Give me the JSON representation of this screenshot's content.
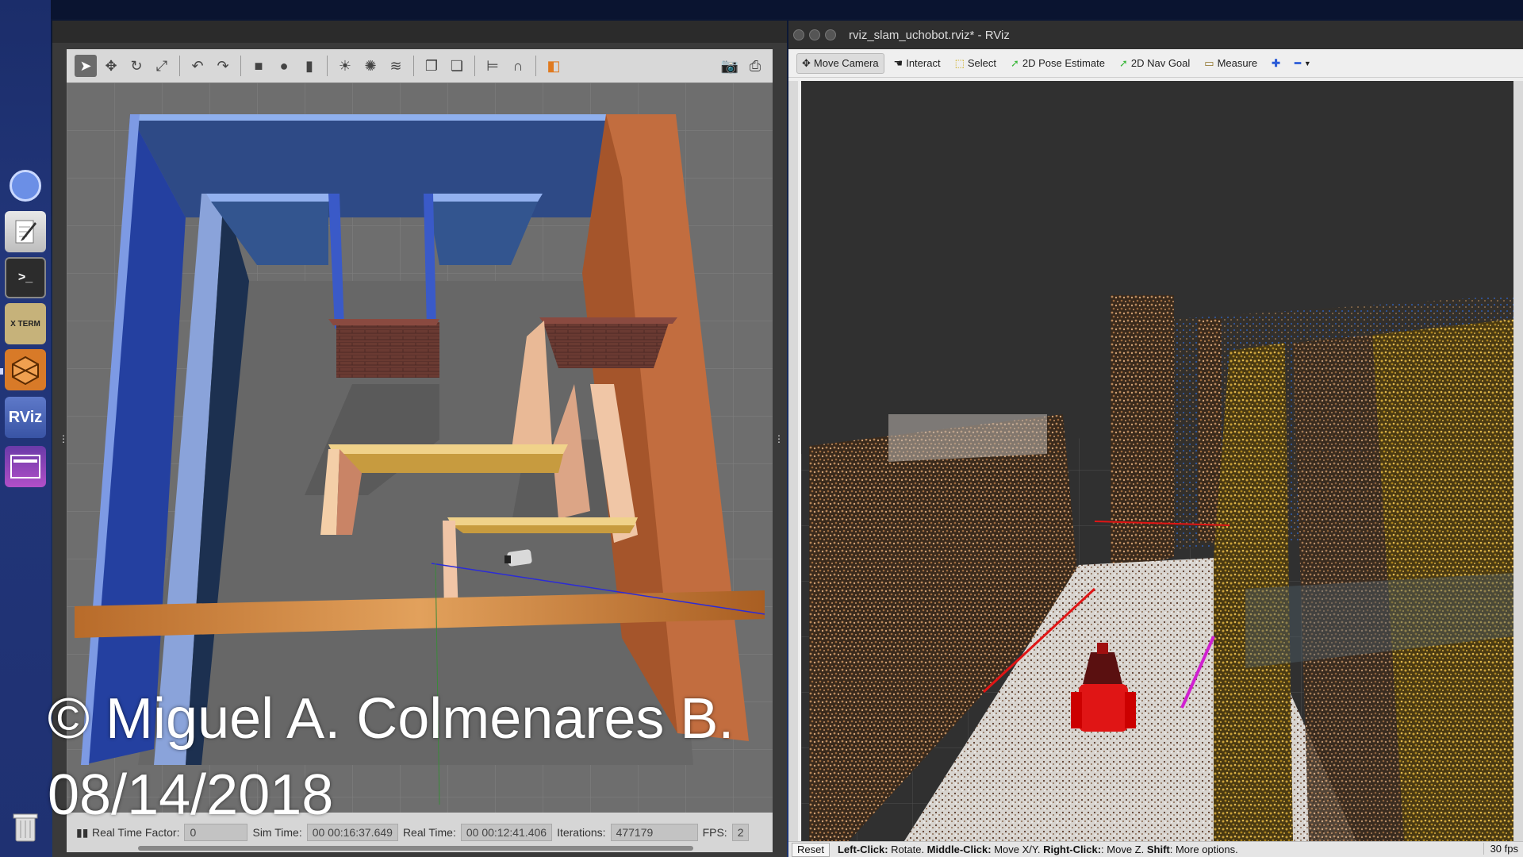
{
  "launcher": {
    "items": [
      {
        "name": "chromium-icon"
      },
      {
        "name": "text-editor-icon"
      },
      {
        "name": "terminal-icon",
        "glyph": ">_"
      },
      {
        "name": "xterm-icon",
        "glyph": "X TERM"
      },
      {
        "name": "gazebo-icon"
      },
      {
        "name": "rviz-icon",
        "glyph": "RViz"
      },
      {
        "name": "app-purple-icon"
      },
      {
        "name": "trash-icon"
      }
    ]
  },
  "gazebo": {
    "status": {
      "real_time_factor_label": "Real Time Factor:",
      "real_time_factor_value": "0",
      "sim_time_label": "Sim Time:",
      "sim_time_value": "00 00:16:37.649",
      "real_time_label": "Real Time:",
      "real_time_value": "00 00:12:41.406",
      "iterations_label": "Iterations:",
      "iterations_value": "477179",
      "fps_label": "FPS:",
      "fps_value": "2"
    }
  },
  "rviz": {
    "title": "rviz_slam_uchobot.rviz* - RViz",
    "tools": {
      "move_camera": "Move Camera",
      "interact": "Interact",
      "select": "Select",
      "pose_estimate": "2D Pose Estimate",
      "nav_goal": "2D Nav Goal",
      "measure": "Measure"
    },
    "bottom": {
      "reset": "Reset",
      "hint_left_label": "Left-Click:",
      "hint_left": " Rotate. ",
      "hint_middle_label": "Middle-Click:",
      "hint_middle": " Move X/Y. ",
      "hint_right_label": "Right-Click:",
      "hint_right": ": Move Z. ",
      "hint_shift_label": "Shift",
      "hint_shift": ": More options.",
      "fps": "30 fps"
    }
  },
  "watermark": {
    "line1": "© Miguel A. Colmenares B.",
    "line2": "08/14/2018"
  },
  "colors": {
    "wall_blue": "#2a4ba8",
    "wall_orange": "#c8774a",
    "wall_yellow": "#d8b25c",
    "floor": "#6f6f6f",
    "rviz_bg": "#303030",
    "robot_red": "#e01515"
  }
}
